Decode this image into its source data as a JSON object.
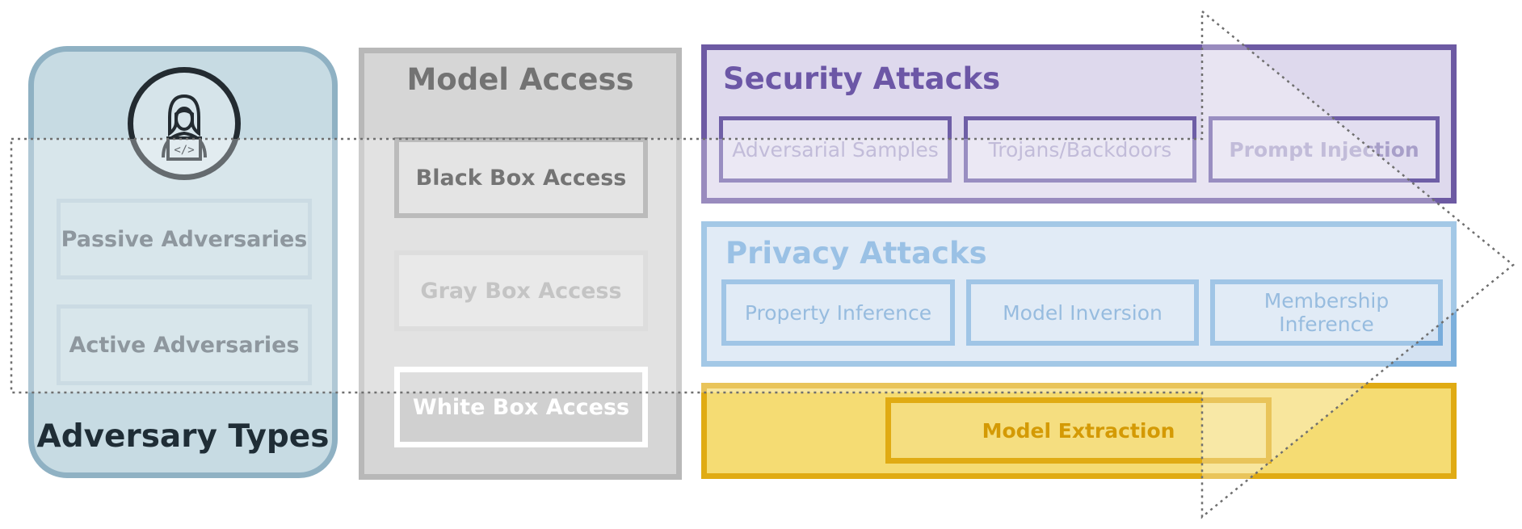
{
  "adversary_types": {
    "title": "Adversary Types",
    "items": [
      "Passive Adversaries",
      "Active Adversaries"
    ],
    "icon": "hacker-laptop-icon"
  },
  "model_access": {
    "title": "Model Access",
    "items": [
      "Black Box Access",
      "Gray Box Access",
      "White Box Access"
    ]
  },
  "security_attacks": {
    "title": "Security Attacks",
    "items": [
      "Adversarial Samples",
      "Trojans/Backdoors",
      "Prompt Injection"
    ]
  },
  "privacy_attacks": {
    "title": "Privacy Attacks",
    "items": [
      "Property Inference",
      "Model Inversion",
      "Membership Inference"
    ]
  },
  "model_extraction": {
    "label": "Model Extraction"
  },
  "colors": {
    "adversary_panel": "#c7dbe3",
    "access_panel": "#d6d6d6",
    "security": "#6d5aa3",
    "privacy": "#7cb0dc",
    "extraction": "#e0ab13"
  }
}
